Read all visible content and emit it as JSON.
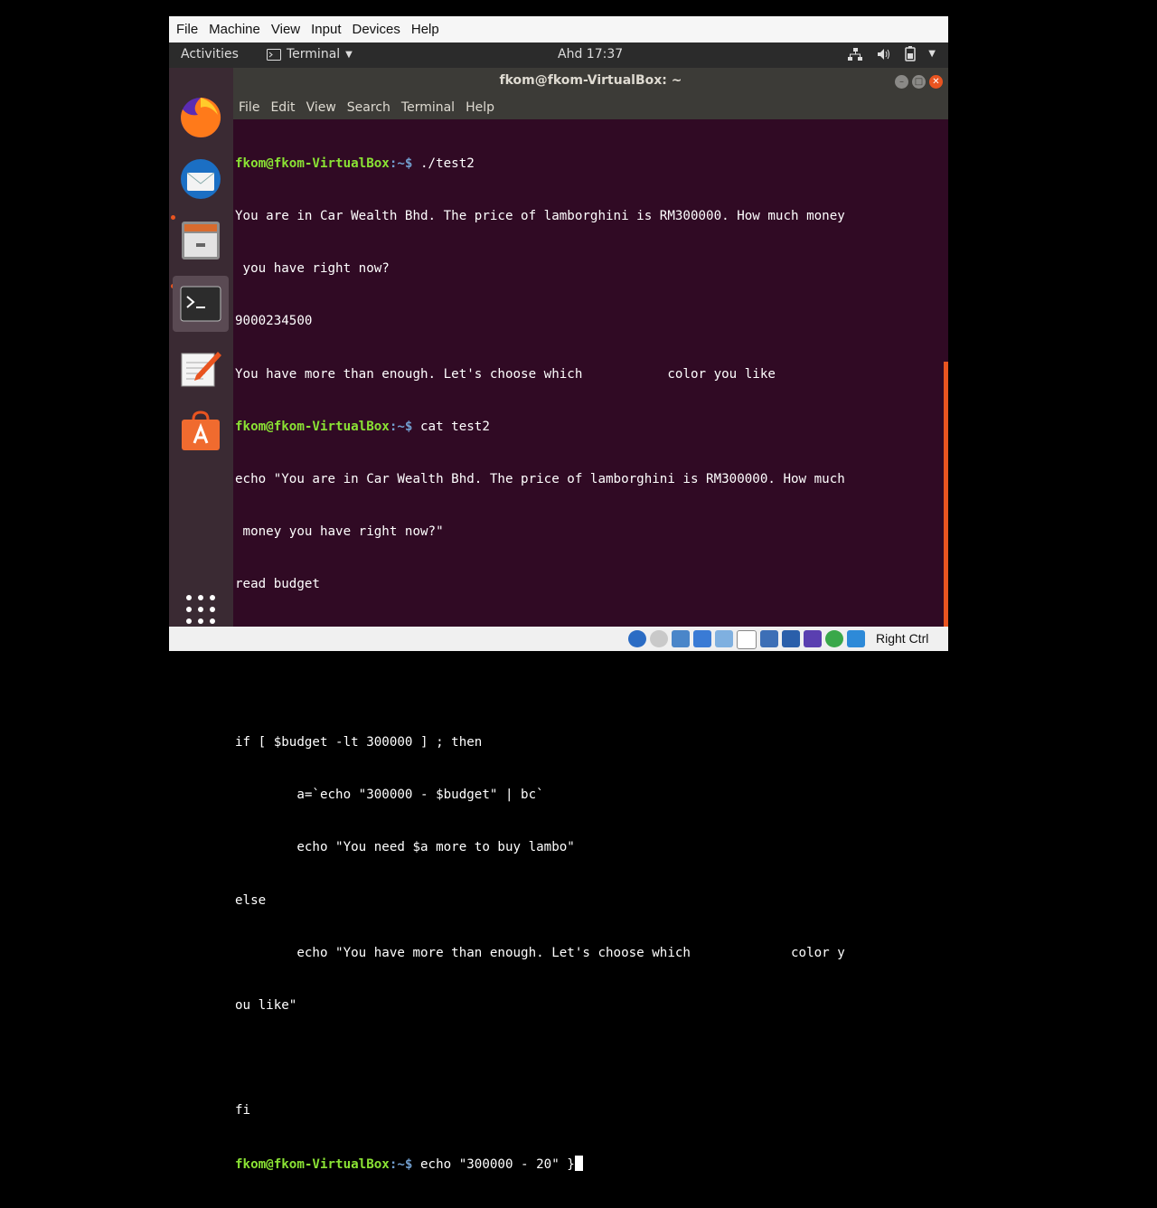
{
  "vbox_menu": [
    "File",
    "Machine",
    "View",
    "Input",
    "Devices",
    "Help"
  ],
  "topbar": {
    "activities": "Activities",
    "app": "Terminal",
    "clock": "Ahd 17:37"
  },
  "window": {
    "title": "fkom@fkom-VirtualBox: ~",
    "menu": [
      "File",
      "Edit",
      "View",
      "Search",
      "Terminal",
      "Help"
    ]
  },
  "terminal": {
    "prompt_user": "fkom@fkom-VirtualBox",
    "prompt_path": ":~$",
    "cmd1": " ./test2",
    "out1": "You are in Car Wealth Bhd. The price of lamborghini is RM300000. How much money",
    "out2": " you have right now?",
    "out3": "9000234500",
    "out4": "You have more than enough. Let's choose which           color you like",
    "cmd2": " cat test2",
    "src1": "echo \"You are in Car Wealth Bhd. The price of lamborghini is RM300000. How much",
    "src2": " money you have right now?\"",
    "src3": "read budget",
    "src4": "if [ $budget -lt 300000 ] ; then",
    "src5": "        a=`echo \"300000 - $budget\" | bc`",
    "src6": "        echo \"You need $a more to buy lambo\"",
    "src7": "else",
    "src8": "        echo \"You have more than enough. Let's choose which             color y",
    "src9": "ou like\"",
    "src10": "fi",
    "cmd3": " echo \"300000 - 20\" }"
  },
  "statusbar": {
    "host_key": "Right Ctrl"
  },
  "colors": {
    "terminal_bg": "#300a24",
    "accent": "#e95420",
    "prompt_user": "#8ae234",
    "prompt_path": "#729fcf"
  }
}
